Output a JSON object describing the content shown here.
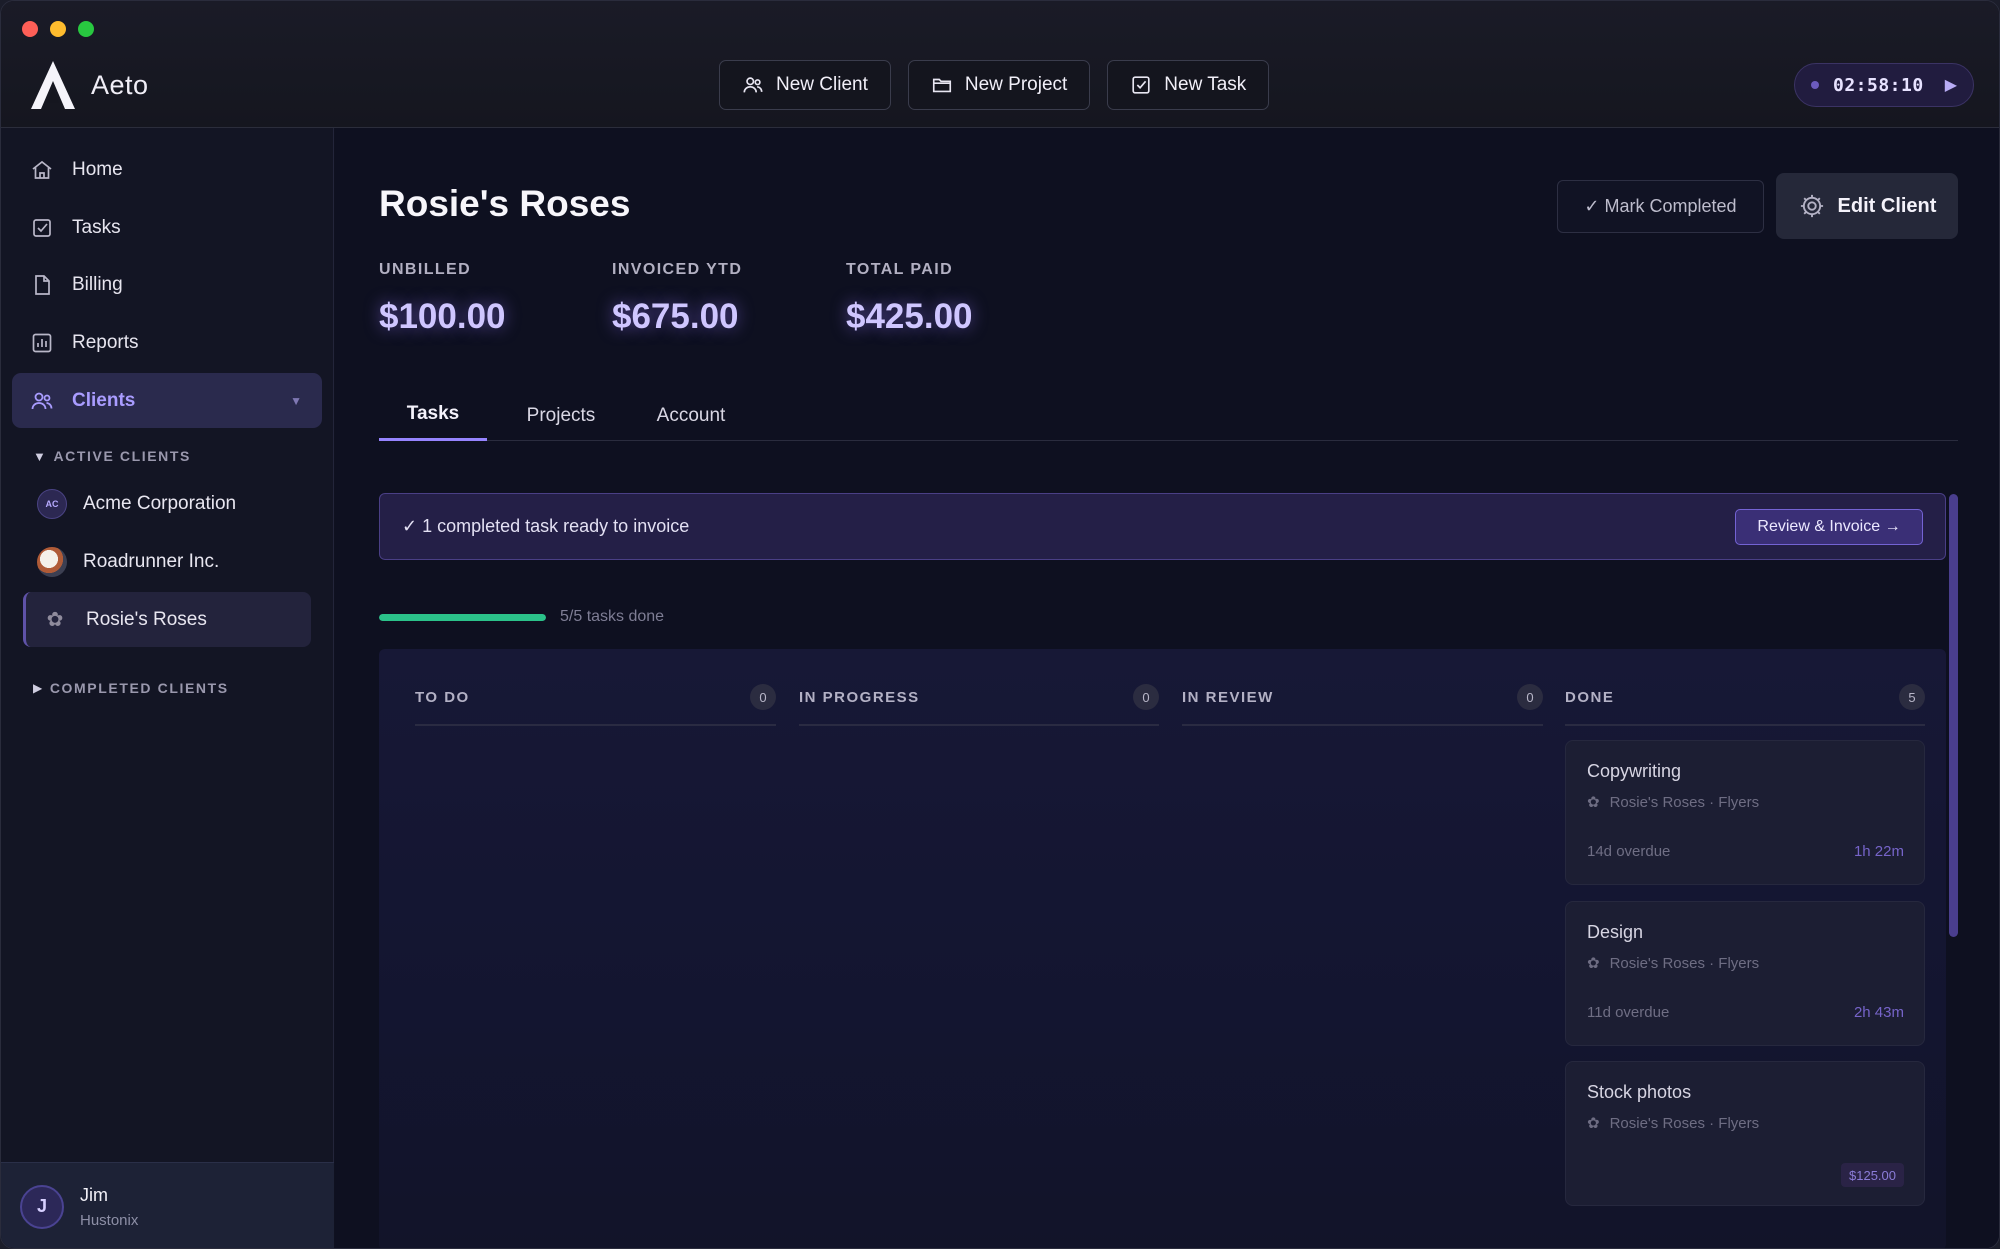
{
  "app": {
    "name": "Aeto",
    "header_buttons": [
      {
        "label": "New Client",
        "icon": "users-icon"
      },
      {
        "label": "New Project",
        "icon": "folder-icon"
      },
      {
        "label": "New Task",
        "icon": "checkbox-icon"
      }
    ],
    "timer": {
      "time": "02:58:10"
    }
  },
  "sidebar": {
    "nav": [
      {
        "label": "Home",
        "icon": "home-icon"
      },
      {
        "label": "Tasks",
        "icon": "checkbox-icon"
      },
      {
        "label": "Billing",
        "icon": "document-icon"
      },
      {
        "label": "Reports",
        "icon": "chart-icon"
      },
      {
        "label": "Clients",
        "icon": "users-icon",
        "active": true
      }
    ],
    "active_clients_label": "ACTIVE CLIENTS",
    "active_clients": [
      {
        "name": "Acme Corporation",
        "initials": "AC"
      },
      {
        "name": "Roadrunner Inc."
      },
      {
        "name": "Rosie's Roses",
        "active": true
      }
    ],
    "completed_clients_label": "COMPLETED CLIENTS",
    "user": {
      "initial": "J",
      "name": "Jim",
      "org": "Hustonix"
    }
  },
  "client": {
    "title": "Rosie's Roses",
    "mark_completed": "✓ Mark Completed",
    "edit_client": "Edit Client",
    "stats": [
      {
        "label": "UNBILLED",
        "value": "$100.00"
      },
      {
        "label": "INVOICED YTD",
        "value": "$675.00"
      },
      {
        "label": "TOTAL PAID",
        "value": "$425.00"
      }
    ],
    "tabs": [
      {
        "label": "Tasks",
        "active": true
      },
      {
        "label": "Projects"
      },
      {
        "label": "Account"
      }
    ],
    "banner": {
      "text": "✓ 1 completed task ready to invoice",
      "button": "Review & Invoice →"
    },
    "progress": {
      "text": "5/5 tasks done",
      "fraction": 1.0
    },
    "accent": "#9684ff",
    "progress_color": "#2bc28a"
  },
  "board": {
    "columns": [
      {
        "title": "TO DO",
        "count": "0",
        "cards": []
      },
      {
        "title": "IN PROGRESS",
        "count": "0",
        "cards": []
      },
      {
        "title": "IN REVIEW",
        "count": "0",
        "cards": []
      },
      {
        "title": "DONE",
        "count": "5",
        "cards": [
          {
            "title": "Copywriting",
            "sub": "Rosie's Roses · Flyers",
            "meta": "14d overdue",
            "time": "1h 22m"
          },
          {
            "title": "Design",
            "sub": "Rosie's Roses · Flyers",
            "meta": "11d overdue",
            "time": "2h 43m"
          },
          {
            "title": "Stock photos",
            "sub": "Rosie's Roses · Flyers",
            "price": "$125.00"
          }
        ]
      }
    ]
  }
}
